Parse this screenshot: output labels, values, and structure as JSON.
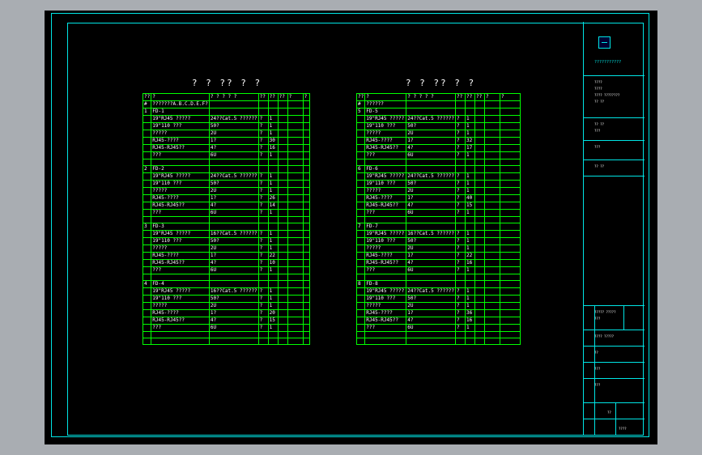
{
  "drawing": {
    "left_title": "? ? ?? ? ?",
    "right_title": "? ? ?? ? ?",
    "header": [
      "??",
      "?",
      "? ? ? ? ?",
      "??",
      "??",
      "??",
      "?",
      "?"
    ],
    "left_rows": [
      [
        "#",
        "???????A.B.C.D.E.F?",
        "",
        "",
        "",
        "",
        "",
        ""
      ],
      [
        "1",
        "FD-1",
        "",
        "",
        "",
        "",
        "",
        ""
      ],
      [
        "",
        "19\"RJ45 ?????",
        "24??Cat.5 ??????",
        "?",
        "1",
        "",
        "",
        ""
      ],
      [
        "",
        "19\"110 ???",
        "50?",
        "?",
        "1",
        "",
        "",
        ""
      ],
      [
        "",
        "?????",
        "2U",
        "?",
        "1",
        "",
        "",
        ""
      ],
      [
        "",
        "RJ45-????",
        "1?",
        "?",
        "30",
        "",
        "",
        ""
      ],
      [
        "",
        "RJ45-RJ45??",
        "4?",
        "?",
        "16",
        "",
        "",
        ""
      ],
      [
        "",
        "???",
        "6U",
        "?",
        "1",
        "",
        "",
        ""
      ],
      [
        "",
        "",
        "",
        "",
        "",
        "",
        "",
        ""
      ],
      [
        "2",
        "FD-2",
        "",
        "",
        "",
        "",
        "",
        ""
      ],
      [
        "",
        "19\"RJ45 ?????",
        "24??Cat.5 ??????",
        "?",
        "1",
        "",
        "",
        ""
      ],
      [
        "",
        "19\"110 ???",
        "50?",
        "?",
        "1",
        "",
        "",
        ""
      ],
      [
        "",
        "?????",
        "2U",
        "?",
        "1",
        "",
        "",
        ""
      ],
      [
        "",
        "RJ45-????",
        "1?",
        "?",
        "26",
        "",
        "",
        ""
      ],
      [
        "",
        "RJ45-RJ45??",
        "4?",
        "?",
        "14",
        "",
        "",
        ""
      ],
      [
        "",
        "???",
        "6U",
        "?",
        "1",
        "",
        "",
        ""
      ],
      [
        "",
        "",
        "",
        "",
        "",
        "",
        "",
        ""
      ],
      [
        "3",
        "FD-3",
        "",
        "",
        "",
        "",
        "",
        ""
      ],
      [
        "",
        "19\"RJ45 ?????",
        "16??Cat.5 ??????",
        "?",
        "1",
        "",
        "",
        ""
      ],
      [
        "",
        "19\"110 ???",
        "50?",
        "?",
        "1",
        "",
        "",
        ""
      ],
      [
        "",
        "?????",
        "2U",
        "?",
        "1",
        "",
        "",
        ""
      ],
      [
        "",
        "RJ45-????",
        "1?",
        "?",
        "22",
        "",
        "",
        ""
      ],
      [
        "",
        "RJ45-RJ45??",
        "4?",
        "?",
        "10",
        "",
        "",
        ""
      ],
      [
        "",
        "???",
        "6U",
        "?",
        "1",
        "",
        "",
        ""
      ],
      [
        "",
        "",
        "",
        "",
        "",
        "",
        "",
        ""
      ],
      [
        "4",
        "FD-4",
        "",
        "",
        "",
        "",
        "",
        ""
      ],
      [
        "",
        "19\"RJ45 ?????",
        "16??Cat.5 ??????",
        "?",
        "1",
        "",
        "",
        ""
      ],
      [
        "",
        "19\"110 ???",
        "50?",
        "?",
        "1",
        "",
        "",
        ""
      ],
      [
        "",
        "?????",
        "2U",
        "?",
        "1",
        "",
        "",
        ""
      ],
      [
        "",
        "RJ45-????",
        "1?",
        "?",
        "20",
        "",
        "",
        ""
      ],
      [
        "",
        "RJ45-RJ45??",
        "4?",
        "?",
        "15",
        "",
        "",
        ""
      ],
      [
        "",
        "???",
        "6U",
        "?",
        "1",
        "",
        "",
        ""
      ],
      [
        "",
        "",
        "",
        "",
        "",
        "",
        "",
        ""
      ],
      [
        "",
        "",
        "",
        "",
        "",
        "",
        "",
        ""
      ]
    ],
    "right_rows": [
      [
        "#",
        "??????",
        "",
        "",
        "",
        "",
        "",
        ""
      ],
      [
        "5",
        "FD-5",
        "",
        "",
        "",
        "",
        "",
        ""
      ],
      [
        "",
        "19\"RJ45 ?????",
        "24??Cat.5 ??????",
        "?",
        "1",
        "",
        "",
        ""
      ],
      [
        "",
        "19\"110 ???",
        "50?",
        "?",
        "1",
        "",
        "",
        ""
      ],
      [
        "",
        "?????",
        "2U",
        "?",
        "1",
        "",
        "",
        ""
      ],
      [
        "",
        "RJ45-????",
        "1?",
        "?",
        "32",
        "",
        "",
        ""
      ],
      [
        "",
        "RJ45-RJ45??",
        "4?",
        "?",
        "17",
        "",
        "",
        ""
      ],
      [
        "",
        "???",
        "6U",
        "?",
        "1",
        "",
        "",
        ""
      ],
      [
        "",
        "",
        "",
        "",
        "",
        "",
        "",
        ""
      ],
      [
        "6",
        "FD-6",
        "",
        "",
        "",
        "",
        "",
        ""
      ],
      [
        "",
        "19\"RJ45 ?????",
        "24??Cat.5 ??????",
        "?",
        "1",
        "",
        "",
        ""
      ],
      [
        "",
        "19\"110 ???",
        "50?",
        "?",
        "1",
        "",
        "",
        ""
      ],
      [
        "",
        "?????",
        "2U",
        "?",
        "1",
        "",
        "",
        ""
      ],
      [
        "",
        "RJ45-????",
        "1?",
        "?",
        "40",
        "",
        "",
        ""
      ],
      [
        "",
        "RJ45-RJ45??",
        "4?",
        "?",
        "15",
        "",
        "",
        ""
      ],
      [
        "",
        "???",
        "6U",
        "?",
        "1",
        "",
        "",
        ""
      ],
      [
        "",
        "",
        "",
        "",
        "",
        "",
        "",
        ""
      ],
      [
        "7",
        "FD-7",
        "",
        "",
        "",
        "",
        "",
        ""
      ],
      [
        "",
        "19\"RJ45 ?????",
        "16??Cat.5 ??????",
        "?",
        "1",
        "",
        "",
        ""
      ],
      [
        "",
        "19\"110 ???",
        "50?",
        "?",
        "1",
        "",
        "",
        ""
      ],
      [
        "",
        "?????",
        "2U",
        "?",
        "1",
        "",
        "",
        ""
      ],
      [
        "",
        "RJ45-????",
        "1?",
        "?",
        "22",
        "",
        "",
        ""
      ],
      [
        "",
        "RJ45-RJ45??",
        "4?",
        "?",
        "16",
        "",
        "",
        ""
      ],
      [
        "",
        "???",
        "6U",
        "?",
        "1",
        "",
        "",
        ""
      ],
      [
        "",
        "",
        "",
        "",
        "",
        "",
        "",
        ""
      ],
      [
        "8",
        "FD-8",
        "",
        "",
        "",
        "",
        "",
        ""
      ],
      [
        "",
        "19\"RJ45 ?????",
        "24??Cat.5 ??????",
        "?",
        "1",
        "",
        "",
        ""
      ],
      [
        "",
        "19\"110 ???",
        "50?",
        "?",
        "1",
        "",
        "",
        ""
      ],
      [
        "",
        "?????",
        "2U",
        "?",
        "1",
        "",
        "",
        ""
      ],
      [
        "",
        "RJ45-????",
        "1?",
        "?",
        "36",
        "",
        "",
        ""
      ],
      [
        "",
        "RJ45-RJ45??",
        "4?",
        "?",
        "16",
        "",
        "",
        ""
      ],
      [
        "",
        "???",
        "6U",
        "?",
        "1",
        "",
        "",
        ""
      ],
      [
        "",
        "",
        "",
        "",
        "",
        "",
        "",
        ""
      ],
      [
        "",
        "",
        "",
        "",
        "",
        "",
        "",
        ""
      ]
    ]
  },
  "title_block": {
    "org_name": "???????????",
    "lines": [
      "????",
      "????",
      "???? ????????",
      "?? ??",
      "?? ??",
      "???",
      "???",
      "?? ??",
      "????? ?????",
      "???",
      "???? ?????",
      "??",
      "???",
      "???"
    ],
    "sheet_no": "??",
    "drawing_no": "????"
  },
  "colors": {
    "frame": "#00e5e5",
    "grid": "#00ff00",
    "table_border": "#ffff00",
    "background": "#000000",
    "canvas": "#a9adb2"
  }
}
